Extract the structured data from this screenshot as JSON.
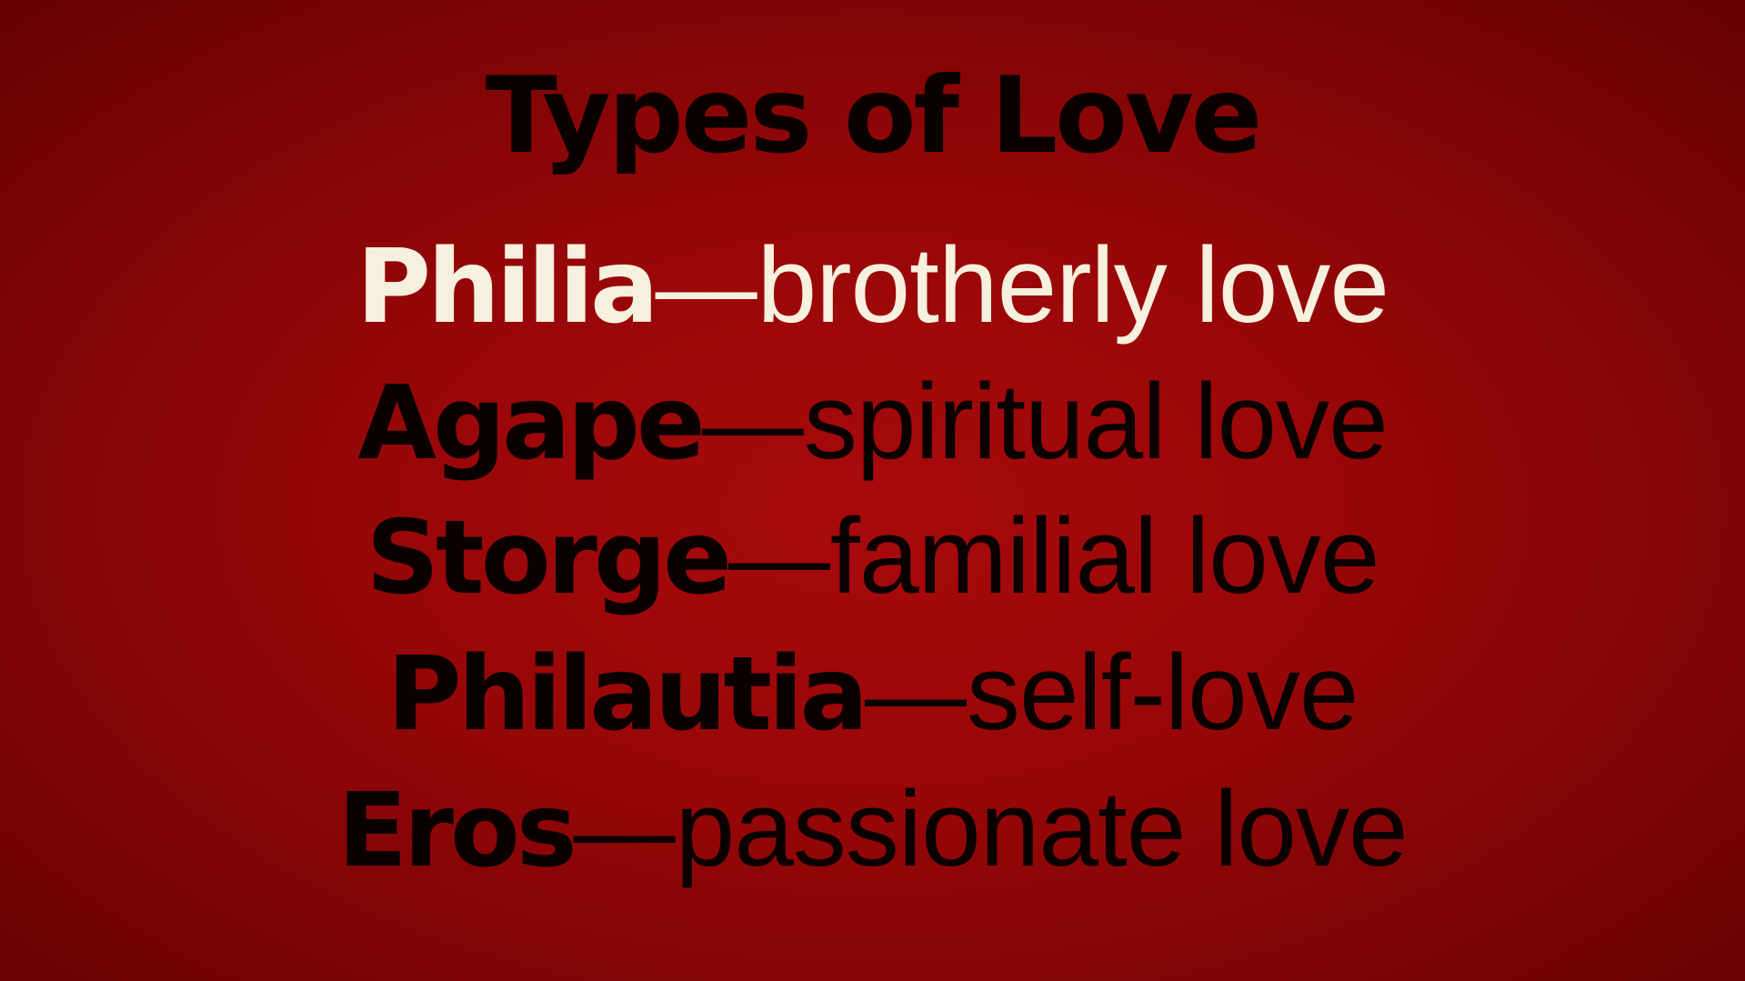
{
  "title": "Types of Love",
  "separator": "—",
  "colors": {
    "background": "#990708",
    "text": "#0b0000",
    "highlight": "#f6f0de"
  },
  "items": [
    {
      "term": "Philia",
      "description": "brotherly love",
      "highlighted": true
    },
    {
      "term": "Agape",
      "description": "spiritual love",
      "highlighted": false
    },
    {
      "term": "Storge",
      "description": "familial love",
      "highlighted": false
    },
    {
      "term": "Philautia",
      "description": "self-love",
      "highlighted": false
    },
    {
      "term": "Eros",
      "description": "passionate love",
      "highlighted": false
    }
  ]
}
